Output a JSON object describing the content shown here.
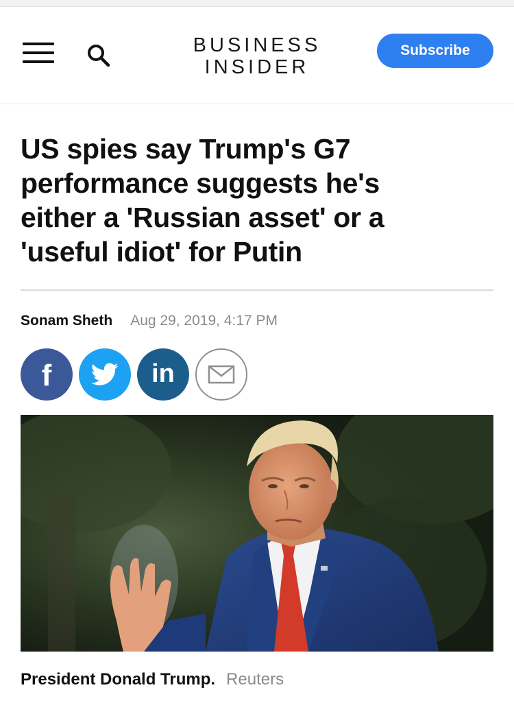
{
  "header": {
    "logo_line1": "BUSINESS",
    "logo_line2": "INSIDER",
    "subscribe_label": "Subscribe",
    "menu_icon": "hamburger-menu-icon",
    "search_icon": "search-icon",
    "accent_color": "#2e7ff0"
  },
  "article": {
    "headline": "US spies say Trump's G7 performance suggests he's either a 'Russian asset' or a 'useful idiot' for Putin",
    "author": "Sonam Sheth",
    "date": "Aug 29, 2019, 4:17 PM"
  },
  "share": {
    "facebook_glyph": "f",
    "linkedin_glyph": "in",
    "buttons": [
      {
        "icon": "facebook-icon",
        "color": "#3b5998"
      },
      {
        "icon": "twitter-icon",
        "color": "#1da1f2"
      },
      {
        "icon": "linkedin-icon",
        "color": "#1b5e8c"
      },
      {
        "icon": "email-icon",
        "color": "#8f8f8f"
      }
    ]
  },
  "photo": {
    "caption": "President Donald Trump.",
    "credit": "Reuters"
  }
}
